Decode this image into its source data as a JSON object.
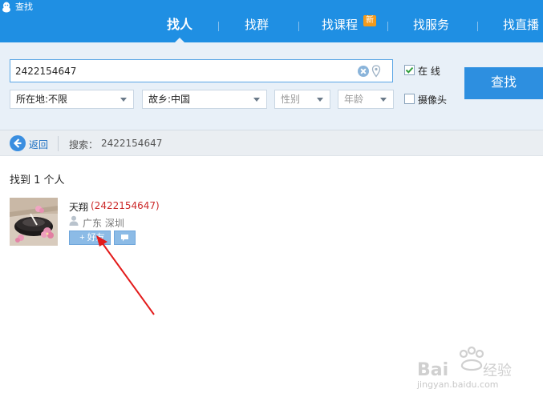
{
  "app": {
    "title": "查找"
  },
  "nav": {
    "tabs": [
      {
        "label": "找人",
        "active": true
      },
      {
        "label": "找群",
        "active": false
      },
      {
        "label": "找课程",
        "active": false,
        "badge": "新"
      },
      {
        "label": "找服务",
        "active": false
      },
      {
        "label": "找直播",
        "active": false
      }
    ]
  },
  "search": {
    "value": "2422154647",
    "online_label": "在 线",
    "online_checked": true,
    "camera_label": "摄像头",
    "camera_checked": false,
    "button_label": "查找",
    "filters": {
      "location": "所在地:不限",
      "hometown": "故乡:中国",
      "gender": "性别",
      "age": "年龄"
    }
  },
  "breadcrumb": {
    "back_label": "返回",
    "search_prefix": "搜索：",
    "search_term": "2422154647"
  },
  "results": {
    "count_text": "找到 1 个人",
    "items": [
      {
        "name": "天翔",
        "qq": "(2422154647)",
        "location": "广东 深圳",
        "add_friend_label": "+ 好友"
      }
    ]
  },
  "watermark": {
    "text": "jingyan.baidu.com",
    "brand": "Baidu 经验"
  },
  "colors": {
    "header": "#1f8fe3",
    "panel": "#e8f0f8",
    "accent": "#2d8fe0",
    "qq_number": "#cc2a2a"
  }
}
